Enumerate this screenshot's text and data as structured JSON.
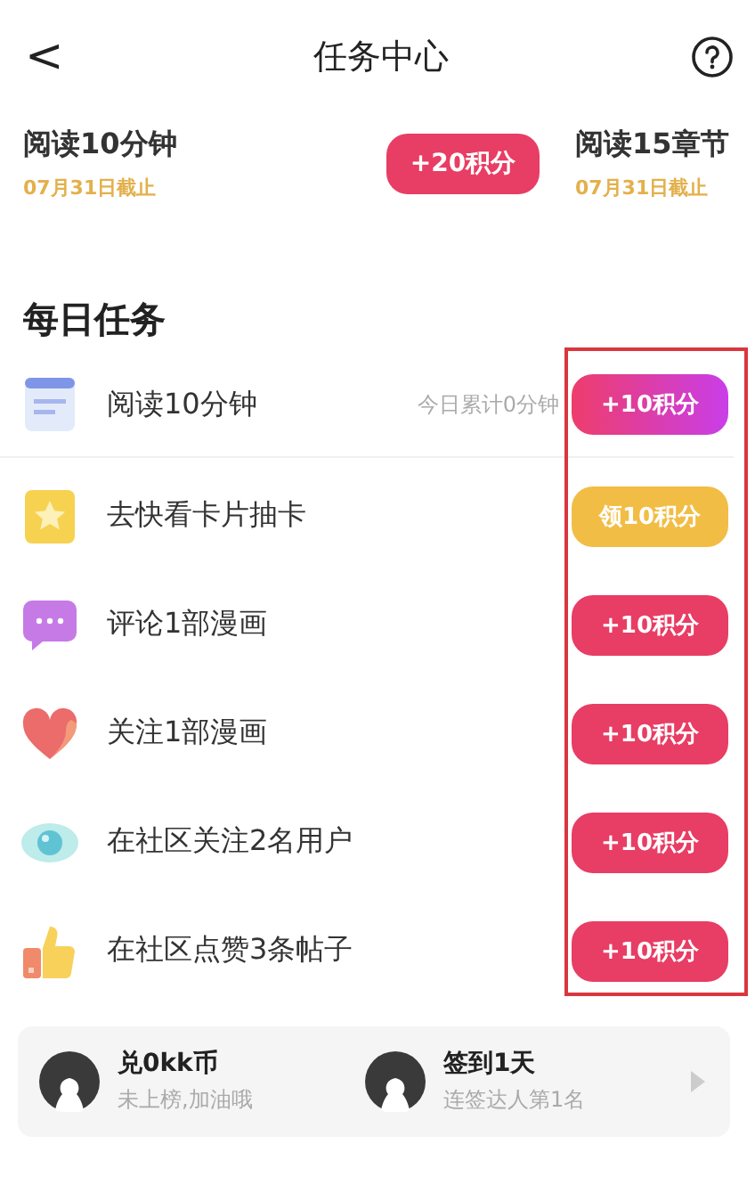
{
  "header": {
    "title": "任务中心",
    "back": "<"
  },
  "featured": [
    {
      "title": "阅读10分钟",
      "deadline": "07月31日截止",
      "reward": "+20积分"
    },
    {
      "title": "阅读15章节",
      "deadline": "07月31日截止"
    }
  ],
  "daily": {
    "heading": "每日任务",
    "highlight_frame": true,
    "tasks": [
      {
        "kind": "doc",
        "label": "阅读10分钟",
        "progress": "今日累计0分钟",
        "button": {
          "label": "+10积分",
          "kind": "gradient"
        }
      },
      {
        "kind": "star",
        "label": "去快看卡片抽卡",
        "button": {
          "label": "领10积分",
          "kind": "gold"
        }
      },
      {
        "kind": "comment",
        "label": "评论1部漫画",
        "button": {
          "label": "+10积分",
          "kind": "red"
        }
      },
      {
        "kind": "heart",
        "label": "关注1部漫画",
        "button": {
          "label": "+10积分",
          "kind": "red"
        }
      },
      {
        "kind": "eye",
        "label": "在社区关注2名用户",
        "button": {
          "label": "+10积分",
          "kind": "red"
        }
      },
      {
        "kind": "thumb",
        "label": "在社区点赞3条帖子",
        "button": {
          "label": "+10积分",
          "kind": "red"
        }
      }
    ]
  },
  "ranking": [
    {
      "title": "兑0kk币",
      "subtitle": "未上榜,加油哦"
    },
    {
      "title": "签到1天",
      "subtitle": "连签达人第1名"
    }
  ]
}
